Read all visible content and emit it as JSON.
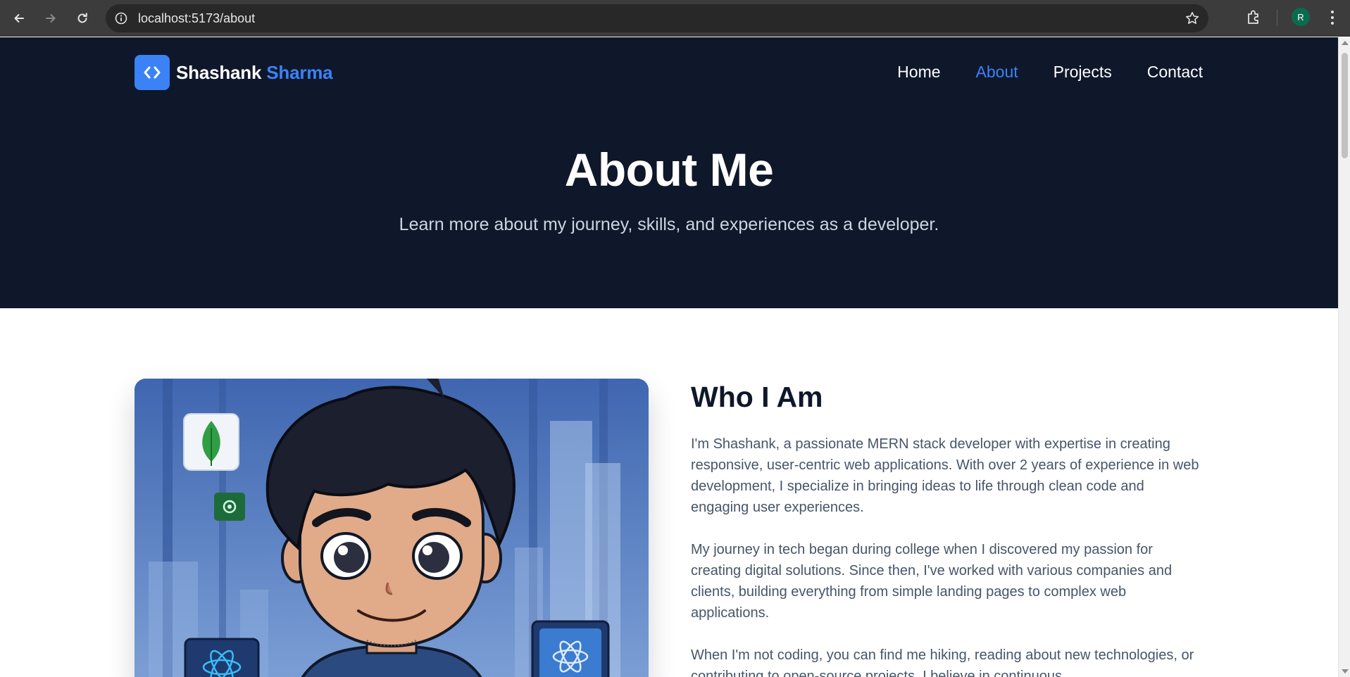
{
  "browser": {
    "url": "localhost:5173/about",
    "profile_initial": "R",
    "icons": [
      "back-arrow-icon",
      "forward-arrow-icon",
      "reload-icon",
      "site-info-icon",
      "bookmark-star-icon",
      "extensions-icon",
      "more-menu-icon"
    ]
  },
  "header": {
    "logo_first": "Shashank",
    "logo_second": "Sharma",
    "logo_icon": "code-brackets-icon",
    "nav": [
      {
        "label": "Home",
        "active": false
      },
      {
        "label": "About",
        "active": true
      },
      {
        "label": "Projects",
        "active": false
      },
      {
        "label": "Contact",
        "active": false
      }
    ]
  },
  "hero": {
    "title": "About Me",
    "subtitle": "Learn more about my journey, skills, and experiences as a developer."
  },
  "about": {
    "heading": "Who I Am",
    "paragraphs": [
      "I'm Shashank, a passionate MERN stack developer with expertise in creating responsive, user-centric web applications. With over 2 years of experience in web development, I specialize in bringing ideas to life through clean code and engaging user experiences.",
      "My journey in tech began during college when I discovered my passion for creating digital solutions. Since then, I've worked with various companies and clients, building everything from simple landing pages to complex web applications.",
      "When I'm not coding, you can find me hiking, reading about new technologies, or contributing to open-source projects. I believe in continuous"
    ]
  },
  "colors": {
    "hero_bg": "#0f172a",
    "accent": "#3b82f6",
    "body_text": "#475569",
    "heading": "#0f172a"
  }
}
